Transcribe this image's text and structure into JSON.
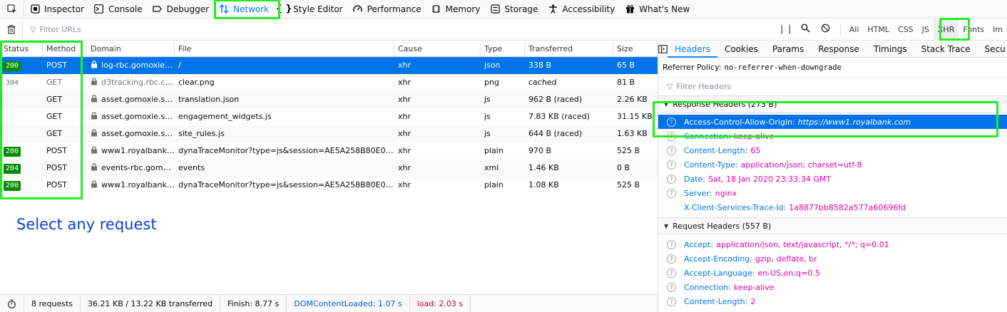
{
  "toolbar": {
    "tabs": [
      {
        "label": "Inspector",
        "icon": "inspector-icon"
      },
      {
        "label": "Console",
        "icon": "console-icon"
      },
      {
        "label": "Debugger",
        "icon": "debugger-icon"
      },
      {
        "label": "Network",
        "icon": "network-icon"
      },
      {
        "label": "Style Editor",
        "icon": "style-editor-icon"
      },
      {
        "label": "Performance",
        "icon": "performance-icon"
      },
      {
        "label": "Memory",
        "icon": "memory-icon"
      },
      {
        "label": "Storage",
        "icon": "storage-icon"
      },
      {
        "label": "Accessibility",
        "icon": "accessibility-icon"
      },
      {
        "label": "What's New",
        "icon": "gift-icon"
      }
    ],
    "active": "Network",
    "accent": "#0a84ff",
    "highlight": "#22ee22"
  },
  "filterbar": {
    "placeholder": "Filter URLs",
    "types": [
      "All",
      "HTML",
      "CSS",
      "JS",
      "XHR",
      "Fonts",
      "Im"
    ],
    "selected_type": "XHR"
  },
  "table": {
    "columns": [
      "Status",
      "Method",
      "Domain",
      "File",
      "Cause",
      "Type",
      "Transferred",
      "Size"
    ],
    "rows": [
      {
        "status": "200",
        "method": "POST",
        "domain": "log-rbc.gomoxie.s...",
        "file": "/",
        "cause": "xhr",
        "type": "json",
        "transferred": "338 B",
        "size": "65 B",
        "selected": true
      },
      {
        "status": "304",
        "method": "GET",
        "domain": "d3tracking.rbc.com",
        "file": "clear.png",
        "cause": "xhr",
        "type": "png",
        "transferred": "cached",
        "size": "81 B",
        "dim": true
      },
      {
        "status": "",
        "method": "GET",
        "domain": "asset.gomoxie.sol...",
        "file": "translation.json",
        "cause": "xhr",
        "type": "js",
        "transferred": "962 B (raced)",
        "size": "2.26 KB"
      },
      {
        "status": "",
        "method": "GET",
        "domain": "asset.gomoxie.sol...",
        "file": "engagement_widgets.js",
        "cause": "xhr",
        "type": "js",
        "transferred": "7.83 KB (raced)",
        "size": "31.15 KB"
      },
      {
        "status": "",
        "method": "GET",
        "domain": "asset.gomoxie.sol...",
        "file": "site_rules.js",
        "cause": "xhr",
        "type": "js",
        "transferred": "644 B (raced)",
        "size": "1.63 KB"
      },
      {
        "status": "200",
        "method": "POST",
        "domain": "www1.royalbank....",
        "file": "dynaTraceMonitor?type=js&session=AE5A258B80E034E6...",
        "cause": "xhr",
        "type": "plain",
        "transferred": "970 B",
        "size": "525 B"
      },
      {
        "status": "204",
        "method": "POST",
        "domain": "events-rbc.gomox...",
        "file": "events",
        "cause": "xhr",
        "type": "xml",
        "transferred": "1.46 KB",
        "size": "0 B"
      },
      {
        "status": "200",
        "method": "POST",
        "domain": "www1.royalbank....",
        "file": "dynaTraceMonitor?type=js&session=AE5A258B80E034E6...",
        "cause": "xhr",
        "type": "plain",
        "transferred": "1.08 KB",
        "size": "525 B"
      }
    ]
  },
  "empty_message": "Select any request",
  "statusbar": {
    "requests": "8 requests",
    "transferred": "36.21 KB / 13.22 KB transferred",
    "finish": "Finish: 8.77 s",
    "dcl": "DOMContentLoaded: 1.07 s",
    "load": "load: 2.03 s"
  },
  "panel": {
    "tabs": [
      "Headers",
      "Cookies",
      "Params",
      "Response",
      "Timings",
      "Stack Trace",
      "Secu"
    ],
    "active_tab": "Headers",
    "referrer_label": "Referrer Policy:",
    "referrer_value": "no-referrer-when-downgrade",
    "filter_placeholder": "Filter Headers",
    "response_title": "Response Headers (273 B)",
    "response_headers": [
      {
        "name": "Access-Control-Allow-Origin:",
        "value": "https://www1.royalbank.com",
        "selected": true
      },
      {
        "name": "Connection:",
        "value": "keep-alive"
      },
      {
        "name": "Content-Length:",
        "value": "65"
      },
      {
        "name": "Content-Type:",
        "value": "application/json; charset=utf-8"
      },
      {
        "name": "Date:",
        "value": "Sat, 18 Jan 2020 23:33:34 GMT"
      },
      {
        "name": "Server:",
        "value": "nginx"
      },
      {
        "name": "X-Client-Services-Trace-Id:",
        "value": "1a8877bb8582a577a60696fd",
        "noicon": true
      }
    ],
    "request_title": "Request Headers (557 B)",
    "request_headers": [
      {
        "name": "Accept:",
        "value": "application/json, text/javascript, */*; q=0.01"
      },
      {
        "name": "Accept-Encoding:",
        "value": "gzip, deflate, br"
      },
      {
        "name": "Accept-Language:",
        "value": "en-US,en;q=0.5"
      },
      {
        "name": "Connection:",
        "value": "keep-alive"
      },
      {
        "name": "Content-Length:",
        "value": "2"
      }
    ]
  }
}
